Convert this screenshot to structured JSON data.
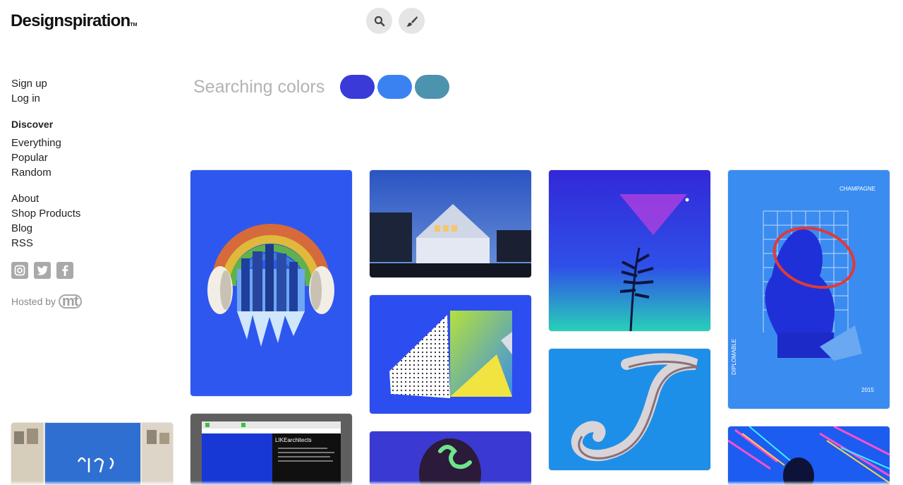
{
  "header": {
    "logo": "Designspiration",
    "logo_tm": "TM",
    "search_icon": "search-icon",
    "brush_icon": "paintbrush-icon"
  },
  "sidebar": {
    "account": [
      "Sign up",
      "Log in"
    ],
    "discover_heading": "Discover",
    "discover": [
      "Everything",
      "Popular",
      "Random"
    ],
    "links": [
      "About",
      "Shop Products",
      "Blog",
      "RSS"
    ],
    "social": [
      "instagram-icon",
      "twitter-icon",
      "facebook-icon"
    ],
    "hosted_by": "Hosted by",
    "hosted_logo": "mt"
  },
  "search": {
    "label": "Searching colors",
    "colors": [
      "#3a3ad8",
      "#3a82f2",
      "#4c94ae"
    ]
  },
  "grid": {
    "tiles": [
      {
        "name": "rainbow-headphones-city-image"
      },
      {
        "name": "house-at-dusk-image"
      },
      {
        "name": "folded-paper-shapes-image"
      },
      {
        "name": "palm-leaf-neon-image"
      },
      {
        "name": "letter-j-typography-image"
      },
      {
        "name": "champagne-bust-poster-image",
        "texts": [
          "CHAMPAGNE",
          "DIPLOMABLE",
          "2015"
        ]
      },
      {
        "name": "like-architects-website-image",
        "texts": [
          "LIKEarchitects"
        ]
      },
      {
        "name": "neon-face-image"
      },
      {
        "name": "glitch-silhouette-image"
      },
      {
        "name": "exhibition-wall-image"
      }
    ]
  }
}
